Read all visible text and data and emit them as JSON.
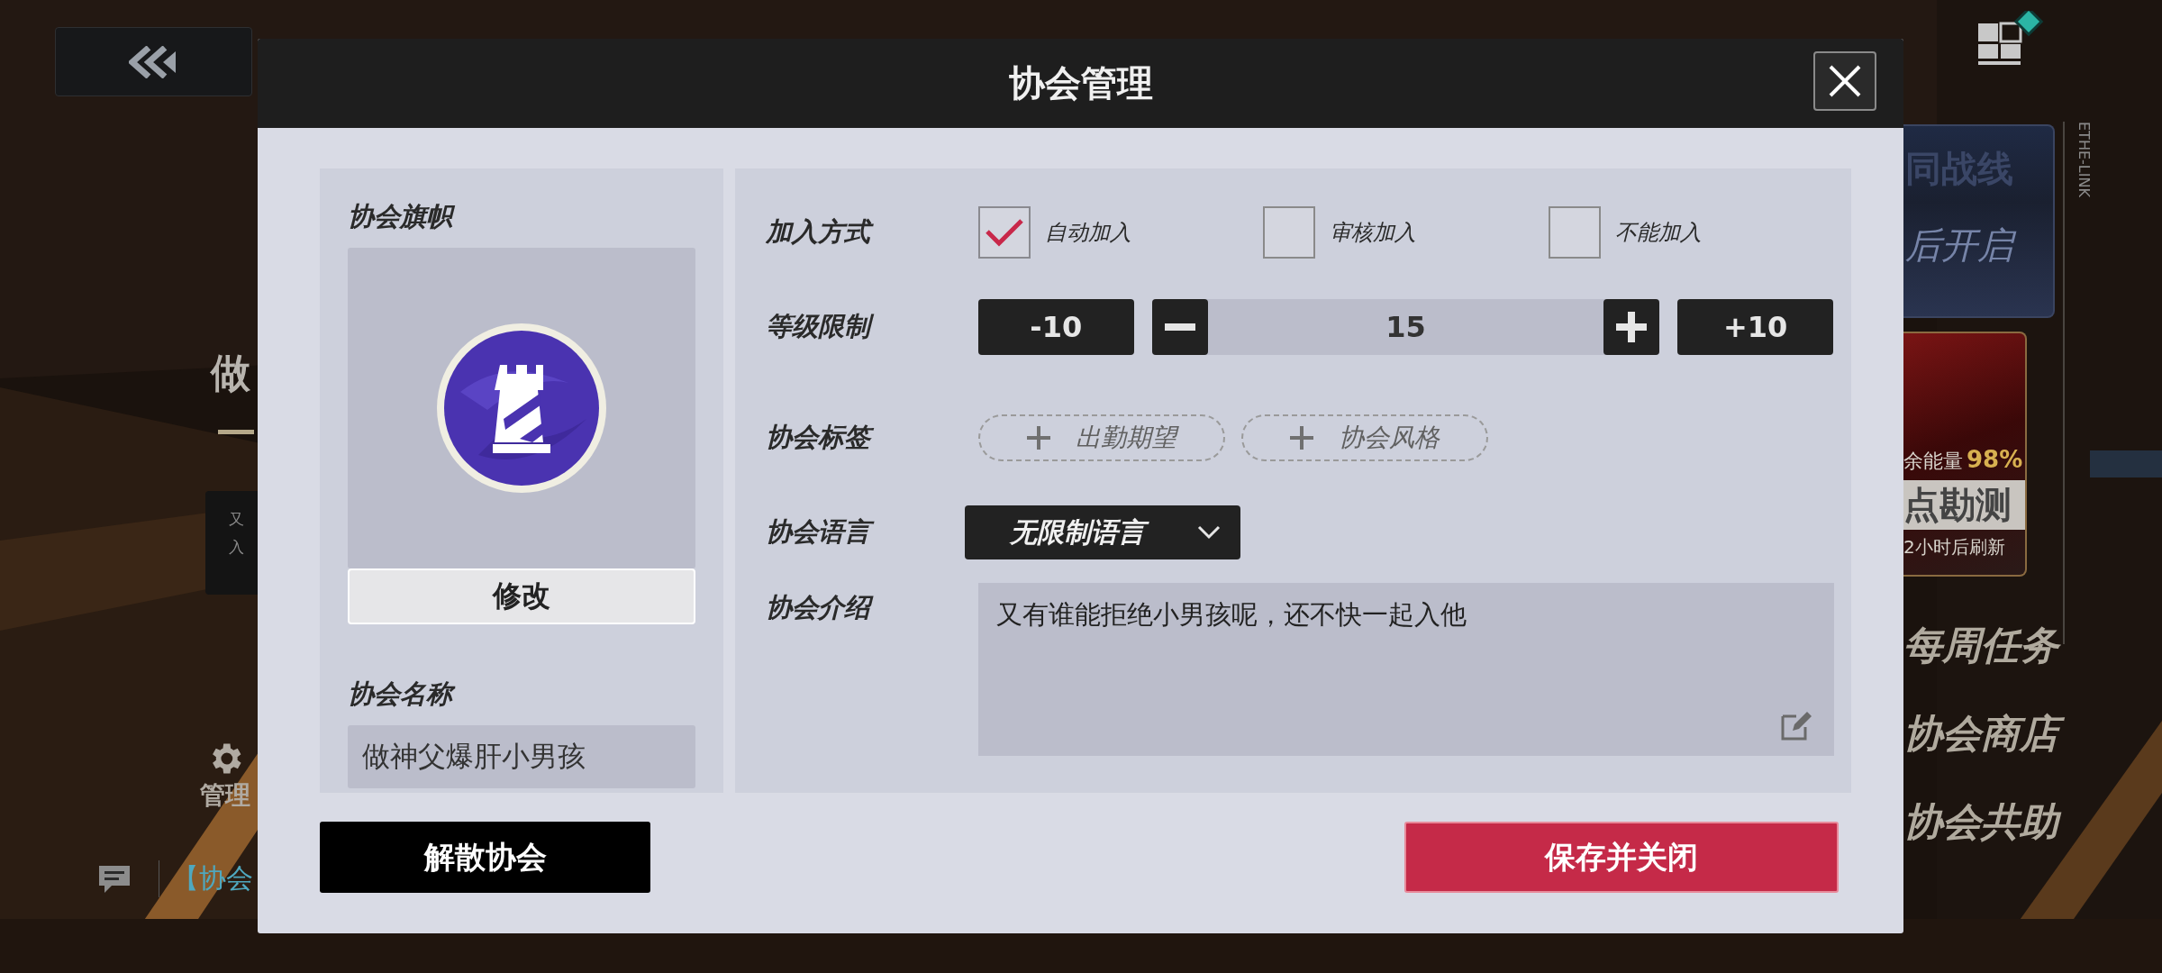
{
  "background_hud": {
    "guild_name": "做",
    "intro_lines": [
      "又",
      "入"
    ],
    "manage_label": "管理",
    "chat_preview": "【协会",
    "side_cards": [
      {
        "kind": "event",
        "title": "同战线",
        "subtitle": "后开启"
      },
      {
        "kind": "survey",
        "energy_label": "余能量",
        "energy_value": "98%",
        "title": "点勘测",
        "subtitle": "2小时后刷新"
      }
    ],
    "menu": [
      "每周任务",
      "协会商店",
      "协会共助"
    ],
    "side_tag": "ETHE-LINK"
  },
  "dialog": {
    "title": "协会管理",
    "flag": {
      "label": "协会旗帜",
      "edit_button": "修改"
    },
    "name": {
      "label": "协会名称",
      "value": "做神父爆肝小男孩"
    },
    "join": {
      "label": "加入方式",
      "options": [
        {
          "label": "自动加入",
          "selected": true
        },
        {
          "label": "审核加入",
          "selected": false
        },
        {
          "label": "不能加入",
          "selected": false
        }
      ]
    },
    "level": {
      "label": "等级限制",
      "minus_ten": "-10",
      "value": "15",
      "plus_ten": "+10"
    },
    "tags": {
      "label": "协会标签",
      "items": [
        "出勤期望",
        "协会风格"
      ]
    },
    "language": {
      "label": "协会语言",
      "value": "无限制语言"
    },
    "intro": {
      "label": "协会介绍",
      "value": "又有谁能拒绝小男孩呢，还不快一起入他"
    },
    "buttons": {
      "dissolve": "解散协会",
      "save": "保存并关闭"
    }
  }
}
